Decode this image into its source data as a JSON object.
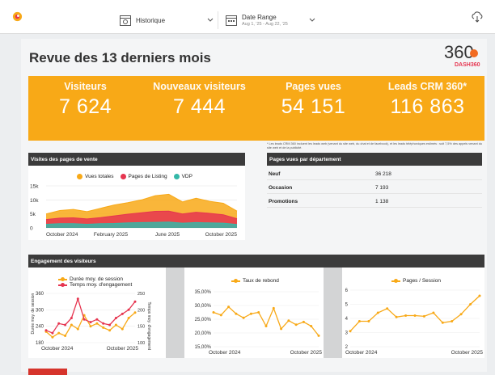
{
  "toolbar": {
    "history_label": "Historique",
    "date_label": "Date Range",
    "date_value": "Aug 1, '25 - Aug 22, '25"
  },
  "page": {
    "title": "Revue des 13 derniers mois",
    "brand_text": "360",
    "brand_sub": "DASH360"
  },
  "kpis": [
    {
      "label": "Visiteurs",
      "value": "7 624"
    },
    {
      "label": "Nouveaux visiteurs",
      "value": "7 444"
    },
    {
      "label": "Pages vues",
      "value": "54 151"
    },
    {
      "label": "Leads CRM 360*",
      "value": "116 863"
    }
  ],
  "kpi_note": "* Les leads CRM 360 incluent les leads web (venant du site web, du chat et de facebook), et les leads téléphoniques estimés : soit 7,5% des appels venant du site web et de la publicité.",
  "sales_pages": {
    "header": "Visites des pages de vente",
    "chart_data": {
      "type": "area",
      "x_ticks": [
        "October 2024",
        "February 2025",
        "June 2025",
        "October 2025"
      ],
      "y_ticks": [
        "15k",
        "10k",
        "5k",
        "0"
      ],
      "ylim": [
        0,
        15000
      ],
      "series": [
        {
          "name": "Vues totales",
          "color": "#f8a917",
          "values": [
            5000,
            6200,
            6600,
            5800,
            7000,
            8200,
            9000,
            10000,
            11500,
            12000,
            9300,
            10600,
            9500,
            8800,
            6000
          ]
        },
        {
          "name": "Pages de Listing",
          "color": "#e63550",
          "values": [
            3000,
            3500,
            3600,
            3200,
            3700,
            4300,
            4900,
            5400,
            5900,
            6000,
            5000,
            5600,
            5200,
            4700,
            3300
          ]
        },
        {
          "name": "VDP",
          "color": "#34b8a8",
          "values": [
            1300,
            1500,
            1500,
            1300,
            1500,
            1600,
            1800,
            1900,
            2000,
            2100,
            1700,
            1900,
            1800,
            1700,
            1200
          ]
        }
      ]
    }
  },
  "dept": {
    "header": "Pages vues par département",
    "rows": [
      {
        "name": "Neuf",
        "value": "36 218"
      },
      {
        "name": "Occasion",
        "value": "7 193"
      },
      {
        "name": "Promotions",
        "value": "1 138"
      }
    ]
  },
  "engagement": {
    "header": "Engagement des visiteurs",
    "chart_data": [
      {
        "type": "line",
        "left_axis_label": "Durée moy. de session",
        "right_axis_label": "Temps moy. d'engagement",
        "left_ticks": [
          "360",
          "300",
          "240",
          "180"
        ],
        "right_ticks": [
          "250",
          "200",
          "150",
          "100"
        ],
        "x_ticks": [
          "October 2024",
          "October 2025"
        ],
        "series": [
          {
            "name": "Durée moy. de session",
            "color": "#f8a917",
            "values": [
              220,
              200,
              215,
              205,
              245,
              230,
              280,
              240,
              250,
              235,
              225,
              245,
              230,
              270,
              290
            ]
          },
          {
            "name": "Temps moy. d'engagement",
            "color": "#e63550",
            "values": [
              225,
              215,
              250,
              245,
              270,
              340,
              265,
              255,
              265,
              250,
              245,
              270,
              285,
              300,
              330
            ]
          }
        ]
      },
      {
        "type": "line",
        "legend": "Taux de rebond",
        "y_ticks": [
          "35,00%",
          "30,00%",
          "25,00%",
          "20,00%",
          "15,00%"
        ],
        "x_ticks": [
          "October 2024",
          "October 2025"
        ],
        "color": "#f8a917",
        "values": [
          27.5,
          26.5,
          29.5,
          27,
          25.5,
          27,
          27.5,
          22.5,
          29,
          21.5,
          24.5,
          23,
          24,
          22.5,
          19
        ]
      },
      {
        "type": "line",
        "legend": "Pages / Session",
        "y_ticks": [
          "6",
          "5",
          "4",
          "3",
          "2"
        ],
        "x_ticks": [
          "October 2024",
          "October 2025"
        ],
        "color": "#f8a917",
        "values": [
          3.1,
          3.8,
          3.8,
          4.4,
          4.7,
          4.1,
          4.2,
          4.2,
          4.15,
          4.4,
          3.7,
          3.8,
          4.3,
          5.0,
          5.6
        ]
      }
    ]
  }
}
